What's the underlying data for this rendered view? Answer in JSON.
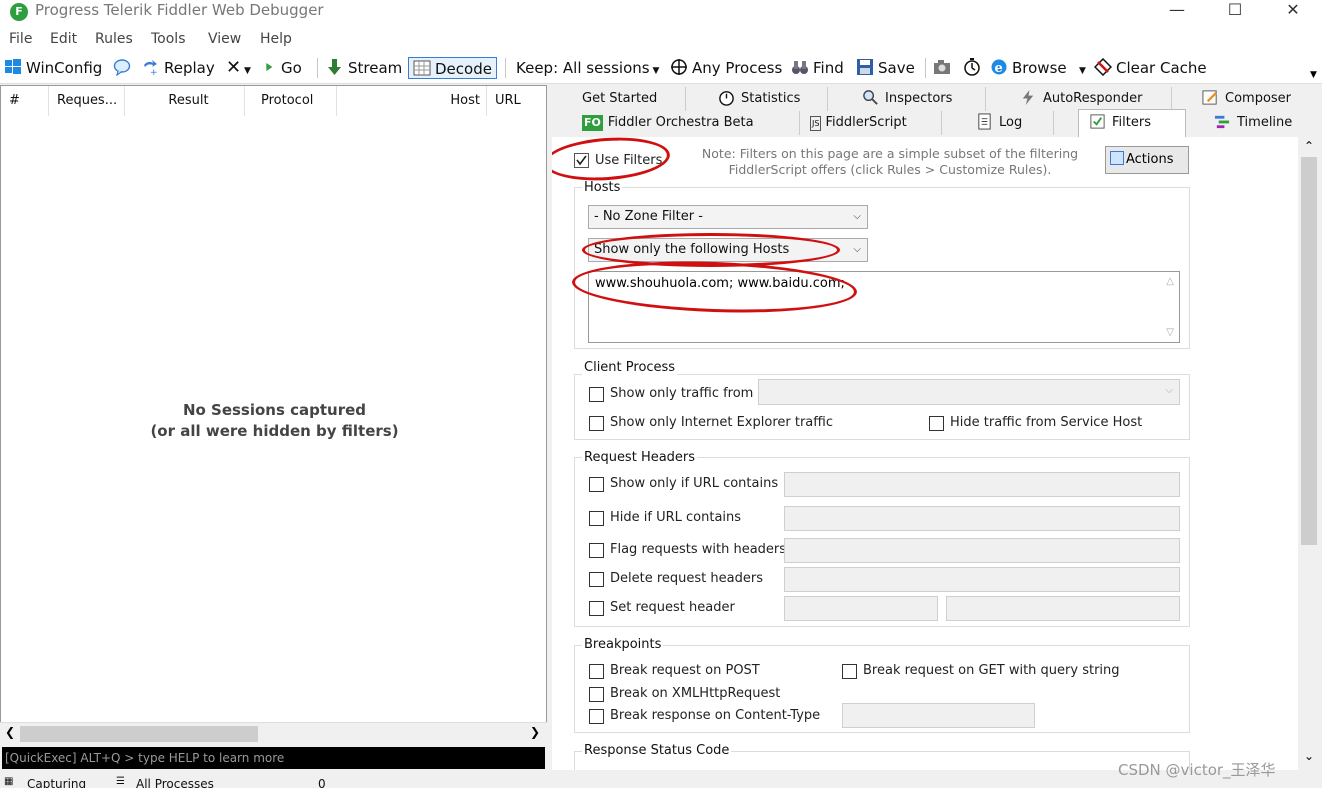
{
  "window": {
    "title": "Progress Telerik Fiddler Web Debugger",
    "logo_letter": "F"
  },
  "menu": [
    "File",
    "Edit",
    "Rules",
    "Tools",
    "View",
    "Help"
  ],
  "toolbar": {
    "winconfig": "WinConfig",
    "replay": "Replay",
    "go": "Go",
    "stream": "Stream",
    "decode": "Decode",
    "keep": "Keep: All sessions",
    "any_process": "Any Process",
    "find": "Find",
    "save": "Save",
    "browse": "Browse",
    "clear_cache": "Clear Cache"
  },
  "sessions": {
    "columns": [
      "#",
      "Reques...",
      "Result",
      "Protocol",
      "Host",
      "URL"
    ],
    "empty_line1": "No Sessions captured",
    "empty_line2": "(or all were hidden by filters)"
  },
  "quickexec": {
    "placeholder": "[QuickExec] ALT+Q > type HELP to learn more"
  },
  "status": {
    "capturing": "Capturing",
    "processes": "All Processes",
    "count": "0"
  },
  "tabs": {
    "row1": [
      "Get Started",
      "Statistics",
      "Inspectors",
      "AutoResponder",
      "Composer"
    ],
    "row2": [
      "FO",
      "Fiddler Orchestra Beta",
      "JS",
      "FiddlerScript",
      "Log",
      "Filters",
      "Timeline"
    ]
  },
  "filters": {
    "use_filters": "Use Filters",
    "note_line1": "Note: Filters on this page are a simple subset of the filtering",
    "note_line2": "FiddlerScript offers (click Rules > Customize Rules).",
    "actions": "Actions",
    "hosts": {
      "label": "Hosts",
      "zone": "- No Zone Filter -",
      "mode": "Show only the following Hosts",
      "list": "www.shouhuola.com; www.baidu.com;"
    },
    "client_process": {
      "label": "Client Process",
      "traffic_from": "Show only traffic from",
      "ie_traffic": "Show only Internet Explorer traffic",
      "hide_service_host": "Hide traffic from Service Host"
    },
    "request_headers": {
      "label": "Request Headers",
      "url_contains": "Show only if URL contains",
      "hide_url": "Hide if URL contains",
      "flag_headers": "Flag requests with headers",
      "delete_headers": "Delete request headers",
      "set_header": "Set request header"
    },
    "breakpoints": {
      "label": "Breakpoints",
      "post": "Break request on POST",
      "get_query": "Break request on GET with query string",
      "xhr": "Break on XMLHttpRequest",
      "content_type": "Break response on Content-Type"
    },
    "response_status": {
      "label": "Response Status Code"
    }
  },
  "watermark": "CSDN @victor_王泽华",
  "colors": {
    "annotation": "#d01010",
    "fiddler_green": "#2e9e3f"
  }
}
